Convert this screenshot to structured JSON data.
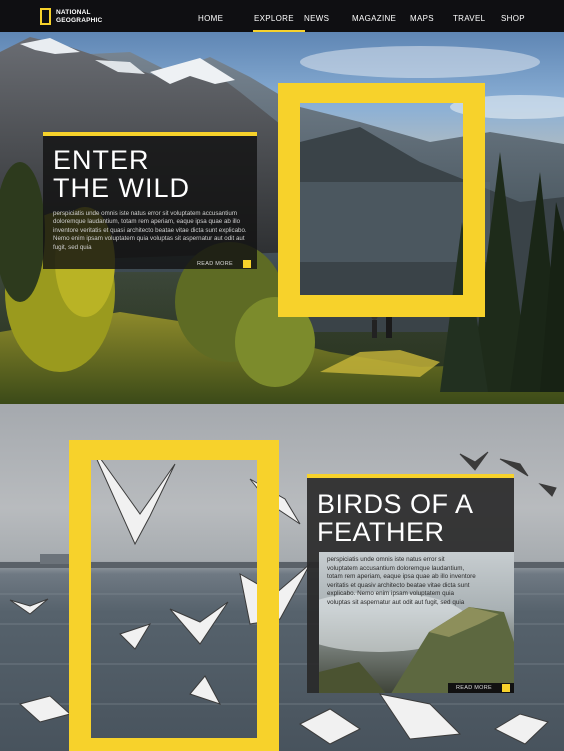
{
  "brand": {
    "line1": "NATIONAL",
    "line2": "GEOGRAPHIC",
    "accent": "#f7d22b"
  },
  "nav": {
    "items": [
      {
        "label": "HOME"
      },
      {
        "label": "EXPLORE",
        "active": true
      },
      {
        "label": "NEWS"
      },
      {
        "label": "MAGAZINE"
      },
      {
        "label": "MAPS"
      },
      {
        "label": "TRAVEL"
      },
      {
        "label": "SHOP"
      }
    ]
  },
  "section1": {
    "title": "ENTER THE WILD",
    "body": "perspiciatis unde omnis iste natus error sit voluptatem accusantium doloremque laudantium, totam rem aperiam, eaque ipsa quae ab illo inventore veritatis et quasi architecto beatae vitae dicta sunt explicabo. Nemo enim ipsam voluptatem quia voluptas sit aspernatur aut odit aut fugit, sed quia",
    "read_more": "READ MORE"
  },
  "section2": {
    "title": "BIRDS OF A FEATHER",
    "body": "perspiciatis unde omnis iste natus error sit voluptatem accusantium doloremque laudantium, totam rem aperiam, eaque ipsa quae ab illo inventore veritatis et quasiv architecto beatae vitae dicta sunt explicabo. Nemo enim ipsam voluptatem quia voluptas sit aspernatur aut odit aut fugit, sed quia",
    "read_more": "READ MORE"
  }
}
